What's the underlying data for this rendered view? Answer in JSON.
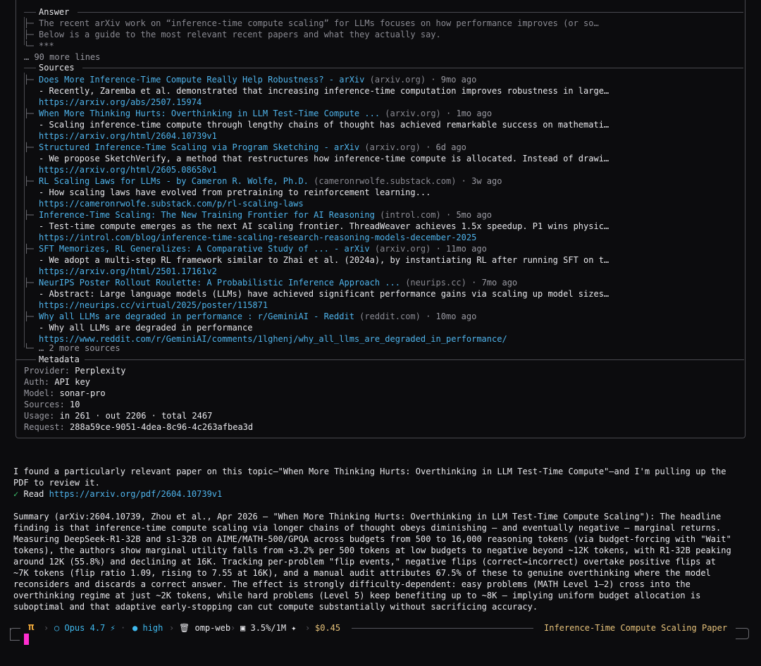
{
  "answer": {
    "heading": "Answer",
    "lines": [
      "The recent arXiv work on “inference-time compute scaling” for LLMs focuses on how performance improves (or so…",
      "Below is a guide to the most relevant recent papers and what they actually say.",
      "***"
    ],
    "more_lines": "… 90 more lines"
  },
  "sources": {
    "heading": "Sources",
    "items": [
      {
        "title": "Does More Inference-Time Compute Really Help Robustness? - arXiv",
        "domain": "(arxiv.org)",
        "age": "· 9mo ago",
        "snippet": "- Recently, Zaremba et al. demonstrated that increasing inference-time computation improves robustness in large…",
        "url": "https://arxiv.org/abs/2507.15974"
      },
      {
        "title": "When More Thinking Hurts: Overthinking in LLM Test-Time Compute ...",
        "domain": "(arxiv.org)",
        "age": "· 1mo ago",
        "snippet": "- Scaling inference-time compute through lengthy chains of thought has achieved remarkable success on mathemati…",
        "url": "https://arxiv.org/html/2604.10739v1"
      },
      {
        "title": "Structured Inference-Time Scaling via Program Sketching - arXiv",
        "domain": "(arxiv.org)",
        "age": "· 6d ago",
        "snippet": "- We propose SketchVerify, a method that restructures how inference-time compute is allocated. Instead of drawi…",
        "url": "https://arxiv.org/html/2605.08658v1"
      },
      {
        "title": "RL Scaling Laws for LLMs - by Cameron R. Wolfe, Ph.D.",
        "domain": "(cameronrwolfe.substack.com)",
        "age": "· 3w ago",
        "snippet": "- How scaling laws have evolved from pretraining to reinforcement learning...",
        "url": "https://cameronrwolfe.substack.com/p/rl-scaling-laws"
      },
      {
        "title": "Inference-Time Scaling: The New Training Frontier for AI Reasoning",
        "domain": "(introl.com)",
        "age": "· 5mo ago",
        "snippet": "- Test-time compute emerges as the next AI scaling frontier. ThreadWeaver achieves 1.5x speedup. P1 wins physic…",
        "url": "https://introl.com/blog/inference-time-scaling-research-reasoning-models-december-2025"
      },
      {
        "title": "SFT Memorizes, RL Generalizes: A Comparative Study of ... - arXiv",
        "domain": "(arxiv.org)",
        "age": "· 11mo ago",
        "snippet": "- We adopt a multi-step RL framework similar to Zhai et al. (2024a), by instantiating RL after running SFT on t…",
        "url": "https://arxiv.org/html/2501.17161v2"
      },
      {
        "title": "NeurIPS Poster Rollout Roulette: A Probabilistic Inference Approach ...",
        "domain": "(neurips.cc)",
        "age": "· 7mo ago",
        "snippet": "- Abstract: Large language models (LLMs) have achieved significant performance gains via scaling up model sizes…",
        "url": "https://neurips.cc/virtual/2025/poster/115871"
      },
      {
        "title": "Why all LLMs are degraded in performance : r/GeminiAI - Reddit",
        "domain": "(reddit.com)",
        "age": "· 10mo ago",
        "snippet": "- Why all LLMs are degraded in performance",
        "url": "https://www.reddit.com/r/GeminiAI/comments/1lghenj/why_all_llms_are_degraded_in_performance/"
      }
    ],
    "more_sources": "… 2 more sources"
  },
  "metadata": {
    "heading": "Metadata",
    "rows": [
      {
        "label": "Provider:",
        "value": "Perplexity"
      },
      {
        "label": "Auth:",
        "value": "API key"
      },
      {
        "label": "Model:",
        "value": "sonar-pro"
      },
      {
        "label": "Sources:",
        "value": "10"
      },
      {
        "label": "Usage:",
        "value": "in 261 · out 2206 · total 2467"
      },
      {
        "label": "Request:",
        "value": "288a59ce-9051-4dea-8c96-4c263afbea3d"
      }
    ]
  },
  "assistant": {
    "intro_1": "I found a particularly relevant paper on this topic—\"When More Thinking Hurts: Overthinking in LLM Test-Time Compute\"—and I'm pulling up the",
    "intro_2": "PDF to review it.",
    "read_check": "✓",
    "read_label": "Read",
    "read_url": "https://arxiv.org/pdf/2604.10739v1",
    "summary": [
      "Summary (arXiv:2604.10739, Zhou et al., Apr 2026 — \"When More Thinking Hurts: Overthinking in LLM Test-Time Compute Scaling\"): The headline",
      "finding is that inference-time compute scaling via longer chains of thought obeys diminishing — and eventually negative — marginal returns.",
      "Measuring DeepSeek-R1-32B and s1-32B on AIME/MATH-500/GPQA across budgets from 500 to 16,000 reasoning tokens (via budget-forcing with \"Wait\"",
      "tokens), the authors show marginal utility falls from +3.2% per 500 tokens at low budgets to negative beyond ~12K tokens, with R1-32B peaking",
      "around 12K (55.8%) and declining at 16K. Tracking per-problem \"flip events,\" negative flips (correct→incorrect) overtake positive flips at",
      "~7K tokens (flip ratio 1.09, rising to 7.55 at 16K), and a manual audit attributes 67.5% of these to genuine overthinking where the model",
      "reconsiders and discards a correct answer. The effect is strongly difficulty-dependent: easy problems (MATH Level 1–2) cross into the",
      "overthinking regime at just ~2K tokens, while hard problems (Level 5) keep benefiting up to ~8K — implying uniform budget allocation is",
      "suboptimal and that adaptive early-stopping can cut compute substantially without sacrificing accuracy."
    ]
  },
  "status_bar": {
    "pi": "π",
    "model_icon": "○",
    "model": "Opus 4.7",
    "bolt": "⚡",
    "dot_sep": "·",
    "effort_icon": "●",
    "effort": "high",
    "trash_icon": "🗑",
    "project": "omp-web",
    "ctx_icon": "▣",
    "context": "3.5%/1M",
    "wand_icon": "✦",
    "cost": "$0.45",
    "session_title": "Inference-Time Compute Scaling Paper",
    "chevron": "›"
  },
  "colors": {
    "link": "#4fb4ec",
    "accent_pi": "#f0a93a",
    "cursor": "#ff2ecf",
    "check": "#3ec46d",
    "session_title": "#e6c27a"
  }
}
